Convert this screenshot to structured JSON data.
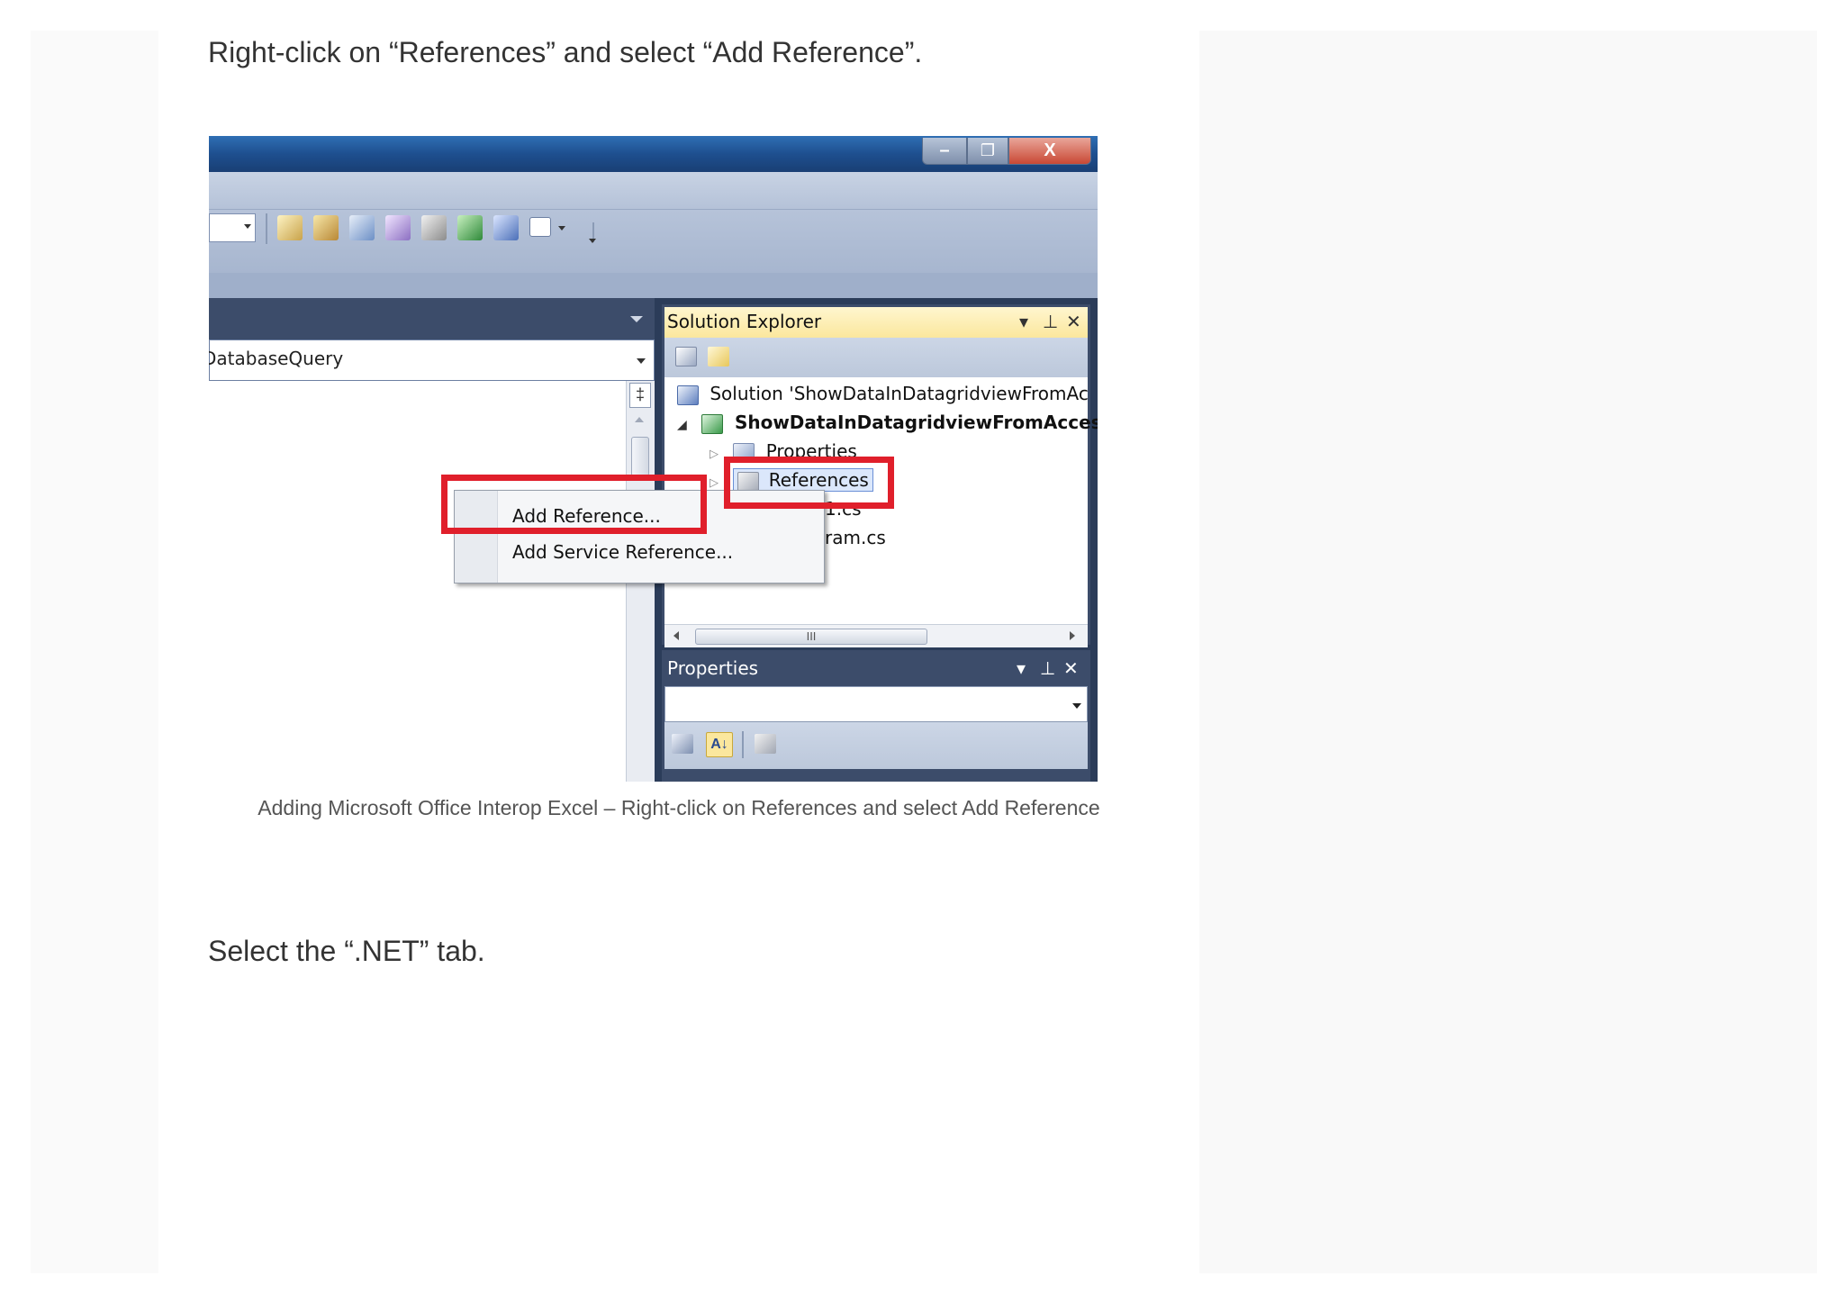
{
  "article": {
    "step1_text": "Right-click on “References” and select “Add Reference”.",
    "caption": "Adding Microsoft Office Interop Excel – Right-click on References and select Add Reference",
    "step2_text": "Select the “.NET” tab."
  },
  "ide": {
    "editor_combo_value": "DatabaseQuery",
    "solution_explorer": {
      "title": "Solution Explorer",
      "solution_label": "Solution 'ShowDataInDatagridviewFromAc",
      "project_label": "ShowDataInDatagridviewFromAcces",
      "items": [
        "Properties",
        "References",
        "1.cs",
        "ram.cs"
      ],
      "hscroll_grip": "III"
    },
    "properties_panel": {
      "title": "Properties"
    },
    "context_menu": {
      "items": [
        "Add Reference...",
        "Add Service Reference..."
      ]
    },
    "window_controls": {
      "minimize": "–",
      "maximize": "❐",
      "close": "X"
    },
    "panel_controls": {
      "dropdown": "▾",
      "pin": "⊥",
      "close": "✕"
    }
  },
  "colors": {
    "highlight_red": "#e01f2b",
    "titlebar_blue": "#1e4f8f",
    "panel_dark": "#3c4c6a",
    "solution_explorer_header": "#fbe79d"
  }
}
